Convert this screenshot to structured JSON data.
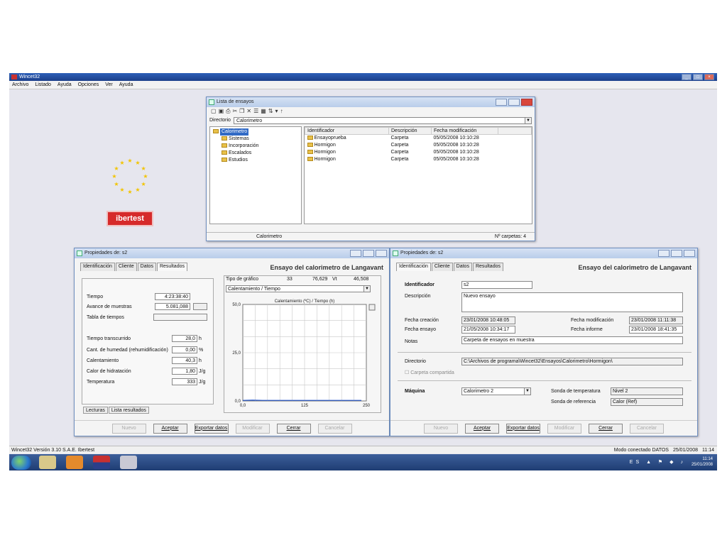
{
  "app": {
    "title": "Wincet32",
    "menu": [
      "Archivo",
      "Listado",
      "Ayuda",
      "Opciones",
      "Ver",
      "Ayuda"
    ]
  },
  "logo": {
    "text": "ibertest",
    "star_color": "#f2c400",
    "badge_color": "#d62a2a"
  },
  "lista": {
    "title": "Lista de ensayos",
    "directory_label": "Directorio",
    "directory_value": "Calorimetro",
    "tree": [
      {
        "label": "Calorimetro",
        "selected": true
      },
      {
        "label": "Sistemas"
      },
      {
        "label": "Incorporación"
      },
      {
        "label": "Escalados"
      },
      {
        "label": "Estudios"
      }
    ],
    "columns": [
      "Identificador",
      "Descripción",
      "Fecha modificación"
    ],
    "rows": [
      {
        "name": "Ensayoprueba",
        "desc": "Carpeta",
        "date": "05/05/2008 10:10:28"
      },
      {
        "name": "Hormigon",
        "desc": "Carpeta",
        "date": "05/05/2008 10:10:28"
      },
      {
        "name": "Hormigon",
        "desc": "Carpeta",
        "date": "05/05/2008 10:10:28"
      },
      {
        "name": "Hormigon",
        "desc": "Carpeta",
        "date": "05/05/2008 10:10:28"
      }
    ],
    "status_left": "Calorimetro",
    "status_right": "Nº carpetas: 4"
  },
  "prop1": {
    "title": "Propiedades de: s2",
    "tabs": [
      "Identificación",
      "Cliente",
      "Datos",
      "Resultados"
    ],
    "heading": "Ensayo del calorimetro de Langavant",
    "fields": [
      {
        "label": "Tiempo",
        "value": "4:23:38:40",
        "unit": ""
      },
      {
        "label": "Avance de muestras",
        "value": "5.081,088",
        "unit": ""
      },
      {
        "label": "Tabla de tiempos",
        "value": "",
        "unit": ""
      },
      {
        "label": "Tiempo transcurrido",
        "value": "28,0",
        "unit": "h"
      },
      {
        "label": "Cant. de humedad (rehumidificación)",
        "value": "0,00",
        "unit": "%"
      },
      {
        "label": "Calentamiento",
        "value": "40,3",
        "unit": "h"
      },
      {
        "label": "Calor de hidratación",
        "value": "1,80",
        "unit": "J/g"
      },
      {
        "label": "Temperatura",
        "value": "333",
        "unit": "J/g"
      }
    ],
    "subtabs": [
      "Lecturas",
      "Lista resultados"
    ],
    "buttons": [
      "Nuevo",
      "Aceptar",
      "Exportar datos",
      "Modificar",
      "Cerrar",
      "Cancelar"
    ],
    "chart_header": {
      "label": "Tipo de gráfico",
      "v1": "33",
      "v2": "76,629",
      "v3": "Vt",
      "v4": "46,508"
    },
    "chart_combo": "Calentamiento / Tiempo"
  },
  "chart_data": {
    "type": "line",
    "title": "Calentamiento (ºC) / Tiempo (h)",
    "xlabel": "",
    "ylabel": "",
    "xlim": [
      0,
      250
    ],
    "ylim": [
      0,
      50
    ],
    "x_ticks": [
      "0,0",
      "125",
      "250"
    ],
    "y_ticks": [
      "0,0",
      "25,0",
      "50,0"
    ],
    "grid": true,
    "series": [
      {
        "x": [
          0,
          20,
          40,
          60,
          80,
          100,
          120,
          140,
          160,
          180,
          200,
          220,
          240
        ],
        "y": [
          0.3,
          0.4,
          0.3,
          0.3,
          0.3,
          0.3,
          0.3,
          0.3,
          0.3,
          0.3,
          0.3,
          0.3,
          0.3
        ]
      }
    ],
    "line_color": "#2255cc"
  },
  "prop2": {
    "title": "Propiedades de: s2",
    "tabs": [
      "Identificación",
      "Cliente",
      "Datos",
      "Resultados"
    ],
    "heading": "Ensayo del calorimetro de Langavant",
    "identificador_label": "Identificador",
    "identificador_value": "s2",
    "descripcion_label": "Descripción",
    "descripcion_value": "Nuevo ensayo",
    "fecha_creacion_label": "Fecha creación",
    "fecha_creacion_value": "23/01/2008 10:48:05",
    "fecha_ensayo_label": "Fecha ensayo",
    "fecha_ensayo_value": "21/05/2008 10:34:17",
    "fecha_modificacion_label": "Fecha modificación",
    "fecha_modificacion_value": "23/01/2008 11:11:38",
    "fecha_informe_label": "Fecha informe",
    "fecha_informe_value": "23/01/2008 18:41:35",
    "notas_label": "Notas",
    "notas_value": "Carpeta de ensayos en muestra",
    "directorio_label": "Directorio",
    "directorio_value": "C:\\Archivos de programa\\Wincet32\\Ensayos\\Calorimetro\\Hormigon\\",
    "checkbox_label": "Carpeta compartida",
    "maquina_label": "Máquina",
    "maquina_value": "Calorimetro 2",
    "sonda1_label": "Sonda de temperatura",
    "sonda1_value": "Nivel 2",
    "sonda2_label": "Sonda de referencia",
    "sonda2_value": "Calor (Ref)",
    "buttons": [
      "Nuevo",
      "Aceptar",
      "Exportar datos",
      "Modificar",
      "Cerrar",
      "Cancelar"
    ]
  },
  "statusbar": {
    "left": "Wincet32 Versión 3.10 S.A.E. Ibertest",
    "right": [
      "Modo conectado DATOS",
      "25/01/2008",
      "11:14"
    ]
  },
  "taskbar": {
    "clock_time": "11:14",
    "clock_date": "25/01/2008",
    "tray": "ES ▲ ⚑ ◆ ♪"
  }
}
